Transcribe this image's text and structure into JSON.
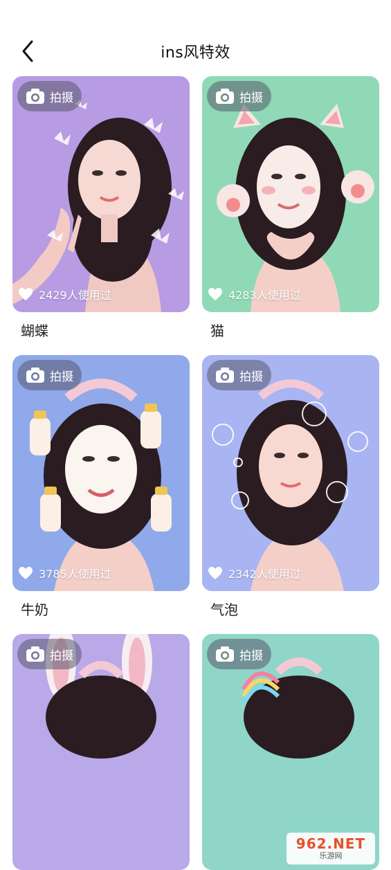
{
  "header": {
    "title": "ins风特效"
  },
  "cards": [
    {
      "shoot_label": "拍摄",
      "usage": "2429人使用过",
      "name": "蝴蝶",
      "bg": "#b79be3"
    },
    {
      "shoot_label": "拍摄",
      "usage": "4283人使用过",
      "name": "猫",
      "bg": "#8fd9b6"
    },
    {
      "shoot_label": "拍摄",
      "usage": "3785人使用过",
      "name": "牛奶",
      "bg": "#8fa9ea"
    },
    {
      "shoot_label": "拍摄",
      "usage": "2342人使用过",
      "name": "气泡",
      "bg": "#a9b4f2"
    },
    {
      "shoot_label": "拍摄",
      "bg": "#b9a9e8"
    },
    {
      "shoot_label": "拍摄",
      "bg": "#8fd6c8"
    }
  ],
  "watermark": {
    "big": "962.NET",
    "small": "乐游网"
  }
}
